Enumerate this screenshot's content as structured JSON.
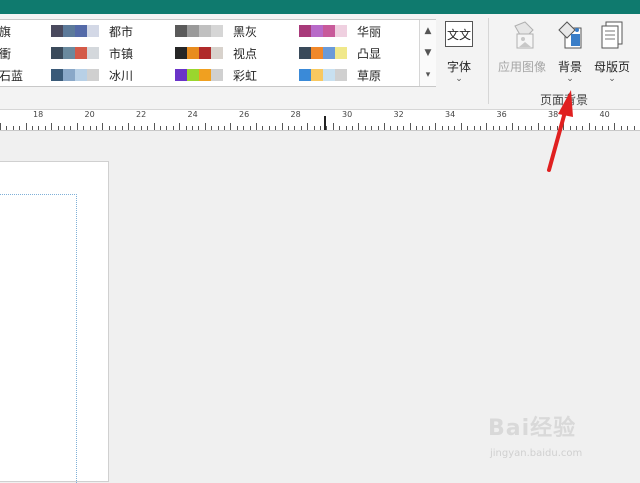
{
  "color_schemes": [
    {
      "label": "旗",
      "colors": [
        "#3f3f54",
        "#3a7ea0",
        "#5a5abf",
        "#d0d8e0"
      ]
    },
    {
      "label": "衝",
      "colors": [
        "#3d4d5e",
        "#5f8fa6",
        "#d46a4f",
        "#d6d6d6"
      ]
    },
    {
      "label": "石蓝",
      "colors": [
        "#0f7a7a",
        "#a0a0c8",
        "#c6dde6",
        "#d0d0d0"
      ]
    },
    {
      "label": "都市",
      "colors": [
        "#4a4a5e",
        "#5c7a9a",
        "#546aa8",
        "#d3d8e6"
      ]
    },
    {
      "label": "市镇",
      "colors": [
        "#3b4b5b",
        "#6a8a9e",
        "#d45a48",
        "#d4d8dc"
      ]
    },
    {
      "label": "冰川",
      "colors": [
        "#3a5a78",
        "#8aa8c8",
        "#b8d0e6",
        "#d0d0d0"
      ]
    },
    {
      "label": "黑灰",
      "colors": [
        "#5a5a5a",
        "#9a9a9a",
        "#c0c0c0",
        "#d6d6d6"
      ]
    },
    {
      "label": "视点",
      "colors": [
        "#262626",
        "#e88c1e",
        "#b02a2a",
        "#d8d2cc"
      ]
    },
    {
      "label": "彩虹",
      "colors": [
        "#6a34c8",
        "#9ad62e",
        "#f0a020",
        "#d0d0d0"
      ]
    },
    {
      "label": "华丽",
      "colors": [
        "#a83a7a",
        "#b86ac8",
        "#c85a9a",
        "#efd0e0"
      ]
    },
    {
      "label": "凸显",
      "colors": [
        "#3a4a5a",
        "#f0882a",
        "#6a9ad8",
        "#f0e88a"
      ]
    },
    {
      "label": "草原",
      "colors": [
        "#3a8ad8",
        "#f8c860",
        "#c8e0f0",
        "#d0d0d0"
      ]
    }
  ],
  "ribbon": {
    "font_button": {
      "icon_text": "文文",
      "label": "字体"
    },
    "apply_image": {
      "label": "应用图像"
    },
    "background": {
      "label": "背景"
    },
    "master_page": {
      "label": "母版页"
    },
    "group_label": "页面背景"
  },
  "ruler": {
    "labels": [
      "18",
      "20",
      "22",
      "24",
      "26",
      "28",
      "30",
      "32",
      "34",
      "36",
      "38",
      "40"
    ]
  },
  "watermark": {
    "brand": "Bai经验",
    "url": "jingyan.baidu.com"
  },
  "colors": {
    "titlebar": "#0f7a6e",
    "annotation_arrow": "#e02020"
  }
}
